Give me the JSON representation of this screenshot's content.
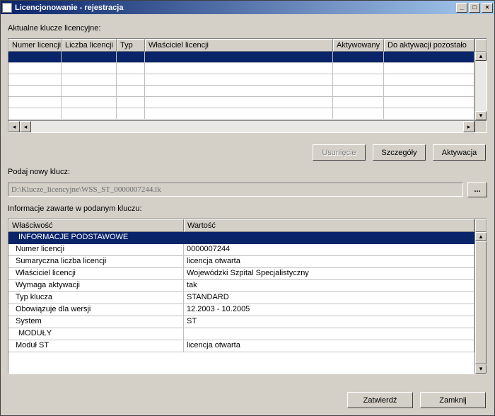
{
  "title": "Licencjonowanie - rejestracja",
  "labels": {
    "aktualne": "Aktualne klucze licencyjne:",
    "podaj_nowy": "Podaj nowy klucz:",
    "info": "Informacje zawarte w podanym kluczu:"
  },
  "grid1": {
    "headers": [
      "Numer licencji",
      "Liczba licencji",
      "Typ",
      "Właściciel licencji",
      "Aktywowany",
      "Do aktywacji pozostało"
    ]
  },
  "buttons": {
    "usuniecie": "Usunięcie",
    "szczegoly": "Szczegóły",
    "aktywacja": "Aktywacja",
    "zatwierdz": "Zatwierdź",
    "zamknij": "Zamknij",
    "browse": "..."
  },
  "key_input": "D:\\Klucze_licencyjne\\WSS_ST_0000007244.lk",
  "grid2": {
    "headers": [
      "Właściwość",
      "Wartość"
    ],
    "rows": [
      {
        "prop": "INFORMACJE PODSTAWOWE",
        "val": "",
        "selected": true,
        "indent": 1
      },
      {
        "prop": "Numer licencji",
        "val": "0000007244",
        "indent": 2
      },
      {
        "prop": "Sumaryczna liczba licencji",
        "val": " licencja otwarta",
        "indent": 2
      },
      {
        "prop": "Właściciel licencji",
        "val": "Wojewódzki Szpital Specjalistyczny",
        "indent": 2
      },
      {
        "prop": "Wymaga aktywacji",
        "val": "tak",
        "indent": 2
      },
      {
        "prop": "Typ klucza",
        "val": "STANDARD",
        "indent": 2
      },
      {
        "prop": "Obowiązuje dla wersji",
        "val": "12.2003 - 10.2005",
        "indent": 2
      },
      {
        "prop": "System",
        "val": "ST",
        "indent": 2
      },
      {
        "prop": "MODUŁY",
        "val": "",
        "indent": 1
      },
      {
        "prop": "Moduł ST",
        "val": "licencja otwarta",
        "indent": 2
      }
    ]
  }
}
